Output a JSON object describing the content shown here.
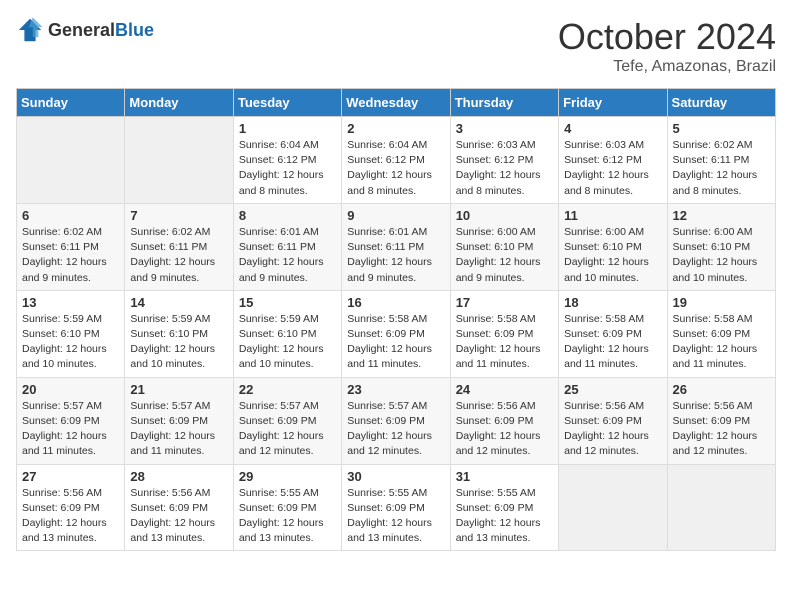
{
  "header": {
    "logo_general": "General",
    "logo_blue": "Blue",
    "month": "October 2024",
    "location": "Tefe, Amazonas, Brazil"
  },
  "days_of_week": [
    "Sunday",
    "Monday",
    "Tuesday",
    "Wednesday",
    "Thursday",
    "Friday",
    "Saturday"
  ],
  "weeks": [
    [
      {
        "day": "",
        "info": ""
      },
      {
        "day": "",
        "info": ""
      },
      {
        "day": "1",
        "info": "Sunrise: 6:04 AM\nSunset: 6:12 PM\nDaylight: 12 hours and 8 minutes."
      },
      {
        "day": "2",
        "info": "Sunrise: 6:04 AM\nSunset: 6:12 PM\nDaylight: 12 hours and 8 minutes."
      },
      {
        "day": "3",
        "info": "Sunrise: 6:03 AM\nSunset: 6:12 PM\nDaylight: 12 hours and 8 minutes."
      },
      {
        "day": "4",
        "info": "Sunrise: 6:03 AM\nSunset: 6:12 PM\nDaylight: 12 hours and 8 minutes."
      },
      {
        "day": "5",
        "info": "Sunrise: 6:02 AM\nSunset: 6:11 PM\nDaylight: 12 hours and 8 minutes."
      }
    ],
    [
      {
        "day": "6",
        "info": "Sunrise: 6:02 AM\nSunset: 6:11 PM\nDaylight: 12 hours and 9 minutes."
      },
      {
        "day": "7",
        "info": "Sunrise: 6:02 AM\nSunset: 6:11 PM\nDaylight: 12 hours and 9 minutes."
      },
      {
        "day": "8",
        "info": "Sunrise: 6:01 AM\nSunset: 6:11 PM\nDaylight: 12 hours and 9 minutes."
      },
      {
        "day": "9",
        "info": "Sunrise: 6:01 AM\nSunset: 6:11 PM\nDaylight: 12 hours and 9 minutes."
      },
      {
        "day": "10",
        "info": "Sunrise: 6:00 AM\nSunset: 6:10 PM\nDaylight: 12 hours and 9 minutes."
      },
      {
        "day": "11",
        "info": "Sunrise: 6:00 AM\nSunset: 6:10 PM\nDaylight: 12 hours and 10 minutes."
      },
      {
        "day": "12",
        "info": "Sunrise: 6:00 AM\nSunset: 6:10 PM\nDaylight: 12 hours and 10 minutes."
      }
    ],
    [
      {
        "day": "13",
        "info": "Sunrise: 5:59 AM\nSunset: 6:10 PM\nDaylight: 12 hours and 10 minutes."
      },
      {
        "day": "14",
        "info": "Sunrise: 5:59 AM\nSunset: 6:10 PM\nDaylight: 12 hours and 10 minutes."
      },
      {
        "day": "15",
        "info": "Sunrise: 5:59 AM\nSunset: 6:10 PM\nDaylight: 12 hours and 10 minutes."
      },
      {
        "day": "16",
        "info": "Sunrise: 5:58 AM\nSunset: 6:09 PM\nDaylight: 12 hours and 11 minutes."
      },
      {
        "day": "17",
        "info": "Sunrise: 5:58 AM\nSunset: 6:09 PM\nDaylight: 12 hours and 11 minutes."
      },
      {
        "day": "18",
        "info": "Sunrise: 5:58 AM\nSunset: 6:09 PM\nDaylight: 12 hours and 11 minutes."
      },
      {
        "day": "19",
        "info": "Sunrise: 5:58 AM\nSunset: 6:09 PM\nDaylight: 12 hours and 11 minutes."
      }
    ],
    [
      {
        "day": "20",
        "info": "Sunrise: 5:57 AM\nSunset: 6:09 PM\nDaylight: 12 hours and 11 minutes."
      },
      {
        "day": "21",
        "info": "Sunrise: 5:57 AM\nSunset: 6:09 PM\nDaylight: 12 hours and 11 minutes."
      },
      {
        "day": "22",
        "info": "Sunrise: 5:57 AM\nSunset: 6:09 PM\nDaylight: 12 hours and 12 minutes."
      },
      {
        "day": "23",
        "info": "Sunrise: 5:57 AM\nSunset: 6:09 PM\nDaylight: 12 hours and 12 minutes."
      },
      {
        "day": "24",
        "info": "Sunrise: 5:56 AM\nSunset: 6:09 PM\nDaylight: 12 hours and 12 minutes."
      },
      {
        "day": "25",
        "info": "Sunrise: 5:56 AM\nSunset: 6:09 PM\nDaylight: 12 hours and 12 minutes."
      },
      {
        "day": "26",
        "info": "Sunrise: 5:56 AM\nSunset: 6:09 PM\nDaylight: 12 hours and 12 minutes."
      }
    ],
    [
      {
        "day": "27",
        "info": "Sunrise: 5:56 AM\nSunset: 6:09 PM\nDaylight: 12 hours and 13 minutes."
      },
      {
        "day": "28",
        "info": "Sunrise: 5:56 AM\nSunset: 6:09 PM\nDaylight: 12 hours and 13 minutes."
      },
      {
        "day": "29",
        "info": "Sunrise: 5:55 AM\nSunset: 6:09 PM\nDaylight: 12 hours and 13 minutes."
      },
      {
        "day": "30",
        "info": "Sunrise: 5:55 AM\nSunset: 6:09 PM\nDaylight: 12 hours and 13 minutes."
      },
      {
        "day": "31",
        "info": "Sunrise: 5:55 AM\nSunset: 6:09 PM\nDaylight: 12 hours and 13 minutes."
      },
      {
        "day": "",
        "info": ""
      },
      {
        "day": "",
        "info": ""
      }
    ]
  ]
}
